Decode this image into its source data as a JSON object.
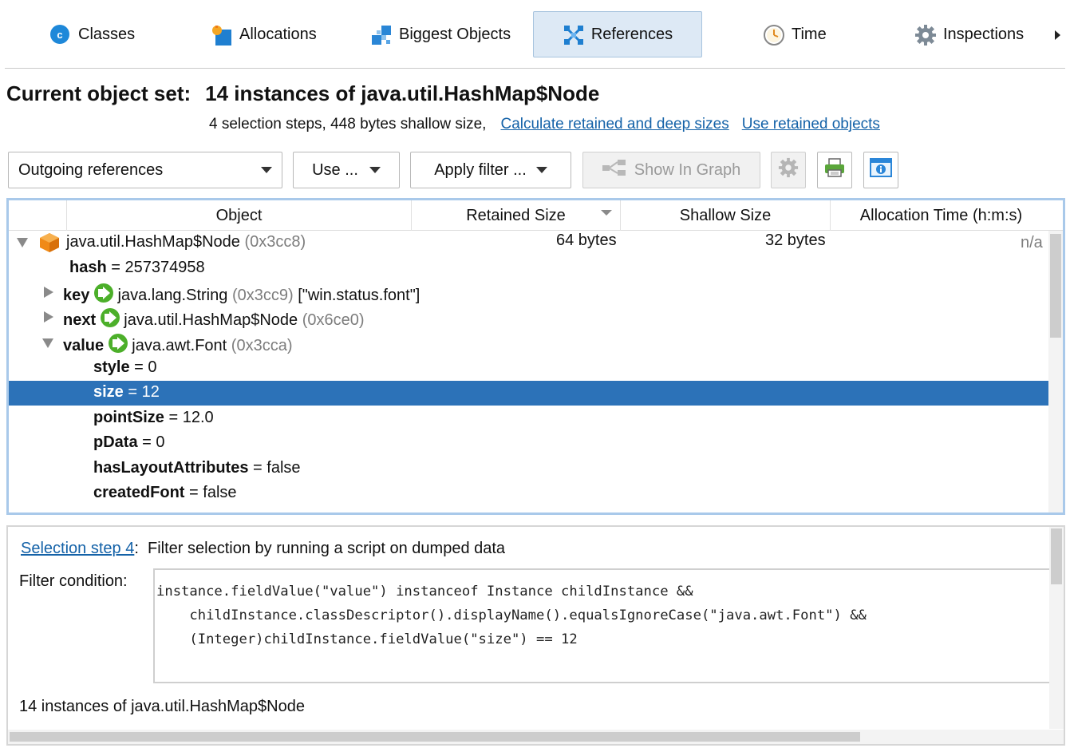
{
  "tabs": [
    {
      "label": "Classes",
      "icon": "classes-icon"
    },
    {
      "label": "Allocations",
      "icon": "allocations-icon"
    },
    {
      "label": "Biggest Objects",
      "icon": "biggest-objects-icon"
    },
    {
      "label": "References",
      "icon": "references-icon",
      "active": true
    },
    {
      "label": "Time",
      "icon": "clock-icon"
    },
    {
      "label": "Inspections",
      "icon": "gear-icon"
    }
  ],
  "header": {
    "label": "Current object set:",
    "value": "14 instances of java.util.HashMap$Node",
    "summary": "4 selection steps, 448 bytes shallow size,",
    "link_calc": "Calculate retained and deep sizes",
    "link_use": "Use retained objects"
  },
  "toolbar": {
    "mode_select": "Outgoing references",
    "use_label": "Use ...",
    "filter_label": "Apply filter ...",
    "graph_label": "Show In Graph"
  },
  "table": {
    "columns": [
      "Object",
      "Retained Size",
      "Shallow Size",
      "Allocation Time (h:m:s)"
    ],
    "root": {
      "name": "java.util.HashMap$Node",
      "id": "(0x3cc8)",
      "retained": "64 bytes",
      "shallow": "32 bytes",
      "alloc": "n/a"
    },
    "hash": {
      "name": "hash",
      "eq": "=",
      "value": "257374958"
    },
    "key": {
      "name": "key",
      "type": "java.lang.String",
      "id": "(0x3cc9)",
      "extra": "[\"win.status.font\"]"
    },
    "next": {
      "name": "next",
      "type": "java.util.HashMap$Node",
      "id": "(0x6ce0)"
    },
    "value": {
      "name": "value",
      "type": "java.awt.Font",
      "id": "(0x3cca)"
    },
    "fields": [
      {
        "name": "style",
        "eq": "=",
        "value": "0"
      },
      {
        "name": "size",
        "eq": "=",
        "value": "12"
      },
      {
        "name": "pointSize",
        "eq": "=",
        "value": "12.0"
      },
      {
        "name": "pData",
        "eq": "=",
        "value": "0"
      },
      {
        "name": "hasLayoutAttributes",
        "eq": "=",
        "value": "false"
      },
      {
        "name": "createdFont",
        "eq": "=",
        "value": "false"
      }
    ]
  },
  "bottom": {
    "step_link": "Selection step 4",
    "step_colon": ":",
    "step_text": "Filter selection by running a script on dumped data",
    "filter_label": "Filter condition:",
    "code_lines": [
      "instance.fieldValue(\"value\") instanceof Instance childInstance &&",
      "    childInstance.classDescriptor().displayName().equalsIgnoreCase(\"java.awt.Font\") &&",
      "    (Integer)childInstance.fieldValue(\"size\") == 12"
    ],
    "result": "14 instances of java.util.HashMap$Node"
  }
}
